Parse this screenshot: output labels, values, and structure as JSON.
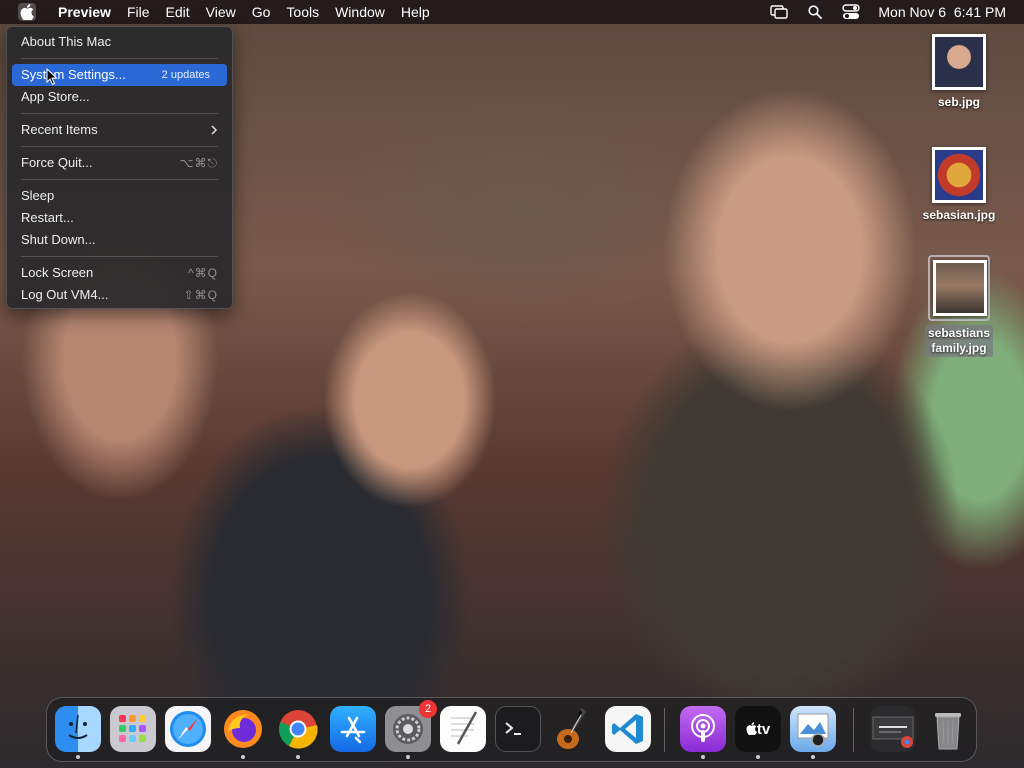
{
  "menubar": {
    "app_name": "Preview",
    "menus": [
      "File",
      "Edit",
      "View",
      "Go",
      "Tools",
      "Window",
      "Help"
    ],
    "datetime": "Mon Nov 6  6:41 PM"
  },
  "apple_menu": {
    "about": "About This Mac",
    "system_settings": "System Settings...",
    "updates_badge": "2 updates",
    "app_store": "App Store...",
    "recent_items": "Recent Items",
    "force_quit": "Force Quit...",
    "force_quit_shortcut": "⌥⌘⎋",
    "sleep": "Sleep",
    "restart": "Restart...",
    "shut_down": "Shut Down...",
    "lock_screen": "Lock Screen",
    "lock_screen_shortcut": "^⌘Q",
    "log_out": "Log Out VM4...",
    "log_out_shortcut": "⇧⌘Q"
  },
  "desktop_icons": [
    {
      "label": "seb.jpg"
    },
    {
      "label": "sebasian.jpg"
    },
    {
      "label_line1": "sebastians",
      "label_line2": "family.jpg"
    }
  ],
  "dock": {
    "items": [
      "finder-icon",
      "launchpad-icon",
      "safari-icon",
      "firefox-icon",
      "chrome-icon",
      "app-store-icon",
      "system-settings-icon",
      "textedit-icon",
      "terminal-icon",
      "garageband-icon",
      "vscode-icon",
      "podcasts-icon",
      "apple-tv-icon",
      "preview-icon",
      "chrome-download-stack-icon",
      "trash-icon"
    ],
    "settings_badge": "2",
    "tv_label": "tv"
  },
  "colors": {
    "menu_highlight": "#2a68d6",
    "badge_red": "#e33333"
  }
}
